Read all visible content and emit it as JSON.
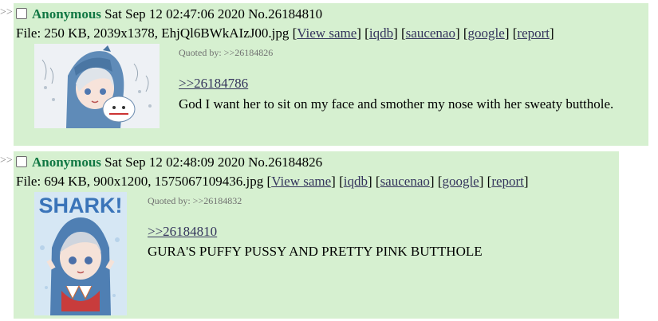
{
  "posts": [
    {
      "arrow": ">>",
      "name": "Anonymous",
      "datetime": "Sat Sep 12 02:47:06 2020",
      "number": "No.26184810",
      "file_prefix": "File: ",
      "file_meta": "250 KB, 2039x1378, EhjQl6BWkAIzJ00.jpg",
      "links": [
        "View same",
        "iqdb",
        "saucenao",
        "google",
        "report"
      ],
      "quoted_by_label": "Quoted by:",
      "quoted_by": ">>26184826",
      "quote": ">>26184786",
      "comment": "God I want her to sit on my face and smother my nose with her sweaty butthole.",
      "thumb_icon": "anime-shark-girl-thumbnail"
    },
    {
      "arrow": ">>",
      "name": "Anonymous",
      "datetime": "Sat Sep 12 02:48:09 2020",
      "number": "No.26184826",
      "file_prefix": "File: ",
      "file_meta": "694 KB, 900x1200, 1575067109436.jpg",
      "links": [
        "View same",
        "iqdb",
        "saucenao",
        "google",
        "report"
      ],
      "quoted_by_label": "Quoted by:",
      "quoted_by": ">>26184832",
      "quote": ">>26184810",
      "comment": "GURA'S PUFFY PUSSY AND PRETTY PINK BUTTHOLE",
      "thumb_text": "SHARK!",
      "thumb_icon": "anime-shark-girl-poster-thumbnail"
    }
  ],
  "colors": {
    "post_bg": "#d6f0d0",
    "name": "#117743",
    "link": "#34345c"
  }
}
